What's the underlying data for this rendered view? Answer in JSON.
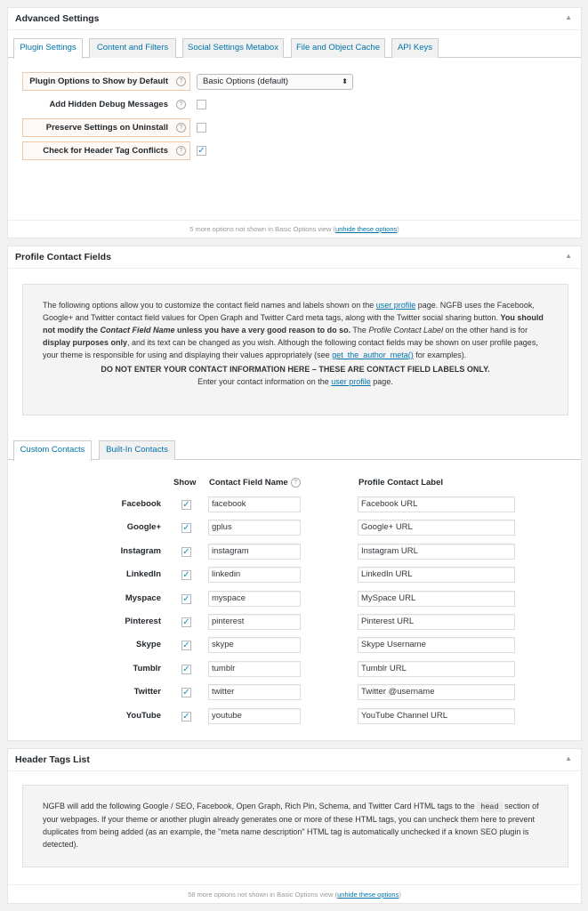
{
  "advanced": {
    "title": "Advanced Settings",
    "tabs": [
      "Plugin Settings",
      "Content and Filters",
      "Social Settings Metabox",
      "File and Object Cache",
      "API Keys"
    ],
    "options": [
      {
        "label": "Plugin Options to Show by Default",
        "highlight": true
      },
      {
        "label": "Add Hidden Debug Messages",
        "highlight": false,
        "checked": false
      },
      {
        "label": "Preserve Settings on Uninstall",
        "highlight": true,
        "checked": false
      },
      {
        "label": "Check for Header Tag Conflicts",
        "highlight": true,
        "checked": true
      }
    ],
    "select_value": "Basic Options (default)",
    "footer_prefix": "5 more options not shown in Basic Options view (",
    "footer_link": "unhide these options",
    "footer_suffix": ")"
  },
  "profile": {
    "title": "Profile Contact Fields",
    "info": {
      "p1_a": "The following options allow you to customize the contact field names and labels shown on the ",
      "p1_link1": "user profile",
      "p1_b": " page. NGFB uses the Facebook, Google+ and Twitter contact field values for Open Graph and Twitter Card meta tags, along with the Twitter social sharing button. ",
      "p1_bold1": "You should not modify the ",
      "p1_bolditalic": "Contact Field Name",
      "p1_bold2": " unless you have a very good reason to do so.",
      "p1_c": " The ",
      "p1_italic": "Profile Contact Label",
      "p1_d": " on the other hand is for ",
      "p1_bold3": "display purposes only",
      "p1_e": ", and its text can be changed as you wish. Although the following contact fields may be shown on user profile pages, your theme is responsible for using and displaying their values appropriately (see ",
      "p1_link2": "get_the_author_meta()",
      "p1_f": " for examples).",
      "warning": "DO NOT ENTER YOUR CONTACT INFORMATION HERE – THESE ARE CONTACT FIELD LABELS ONLY.",
      "p3_a": "Enter your contact information on the ",
      "p3_link": "user profile",
      "p3_b": " page."
    },
    "tabs": [
      "Custom Contacts",
      "Built-In Contacts"
    ],
    "headers": {
      "show": "Show",
      "field_name": "Contact Field Name",
      "label": "Profile Contact Label"
    },
    "rows": [
      {
        "name": "Facebook",
        "field": "facebook",
        "label": "Facebook URL"
      },
      {
        "name": "Google+",
        "field": "gplus",
        "label": "Google+ URL"
      },
      {
        "name": "Instagram",
        "field": "instagram",
        "label": "Instagram URL"
      },
      {
        "name": "LinkedIn",
        "field": "linkedin",
        "label": "LinkedIn URL"
      },
      {
        "name": "Myspace",
        "field": "myspace",
        "label": "MySpace URL"
      },
      {
        "name": "Pinterest",
        "field": "pinterest",
        "label": "Pinterest URL"
      },
      {
        "name": "Skype",
        "field": "skype",
        "label": "Skype Username"
      },
      {
        "name": "Tumblr",
        "field": "tumblr",
        "label": "Tumblr URL"
      },
      {
        "name": "Twitter",
        "field": "twitter",
        "label": "Twitter @username"
      },
      {
        "name": "YouTube",
        "field": "youtube",
        "label": "YouTube Channel URL"
      }
    ]
  },
  "header_tags": {
    "title": "Header Tags List",
    "info_a": "NGFB will add the following Google / SEO, Facebook, Open Graph, Rich Pin, Schema, and Twitter Card HTML tags to the ",
    "info_code": "head",
    "info_b": " section of your webpages. If your theme or another plugin already generates one or more of these HTML tags, you can uncheck them here to prevent duplicates from being added (as an example, the \"meta name description\" HTML tag is automatically unchecked if a known SEO plugin is detected).",
    "footer_prefix": "58 more options not shown in Basic Options view (",
    "footer_link": "unhide these options",
    "footer_suffix": ")"
  },
  "icons": {
    "toggle": "collapse-arrow-icon",
    "help": "help-question-icon",
    "check": "checkmark-icon"
  },
  "colors": {
    "link": "#0073aa",
    "checkmark": "#1e8cbe",
    "highlight_border": "#f0c8a8"
  }
}
